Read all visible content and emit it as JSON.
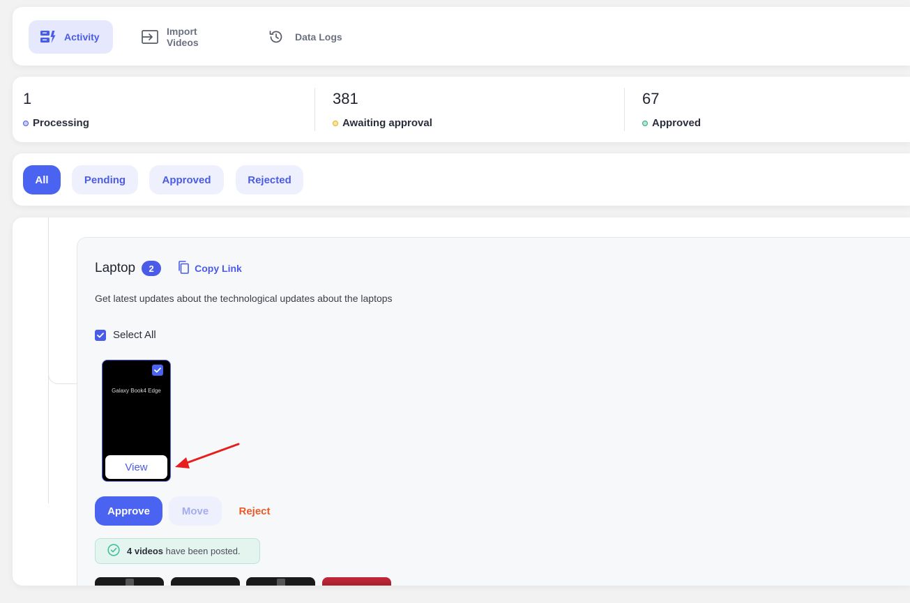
{
  "nav": {
    "items": [
      {
        "label": "Activity",
        "icon": "activity-icon",
        "active": true
      },
      {
        "label": "Import Videos",
        "icon": "import-icon",
        "active": false
      },
      {
        "label": "Data Logs",
        "icon": "history-icon",
        "active": false
      }
    ]
  },
  "stats": [
    {
      "value": "1",
      "label": "Processing",
      "color": "#6b7be8"
    },
    {
      "value": "381",
      "label": "Awaiting approval",
      "color": "#f5c542"
    },
    {
      "value": "67",
      "label": "Approved",
      "color": "#3fbf9a"
    }
  ],
  "filters": {
    "tabs": [
      {
        "label": "All",
        "active": true
      },
      {
        "label": "Pending",
        "active": false
      },
      {
        "label": "Approved",
        "active": false
      },
      {
        "label": "Rejected",
        "active": false
      }
    ]
  },
  "group": {
    "title": "Laptop",
    "count": "2",
    "copy_link_label": "Copy Link",
    "description": "Get latest updates about the technological updates about the laptops",
    "select_all_label": "Select All",
    "video": {
      "title": "Galaxy Book4 Edge",
      "view_label": "View",
      "checked": true
    },
    "actions": {
      "approve": "Approve",
      "move": "Move",
      "reject": "Reject"
    },
    "notice": {
      "count_text": "4 videos",
      "suffix_text": "have been posted."
    }
  },
  "colors": {
    "accent": "#4a63f0",
    "reject": "#e85a2a",
    "success": "#3fbf9a"
  }
}
